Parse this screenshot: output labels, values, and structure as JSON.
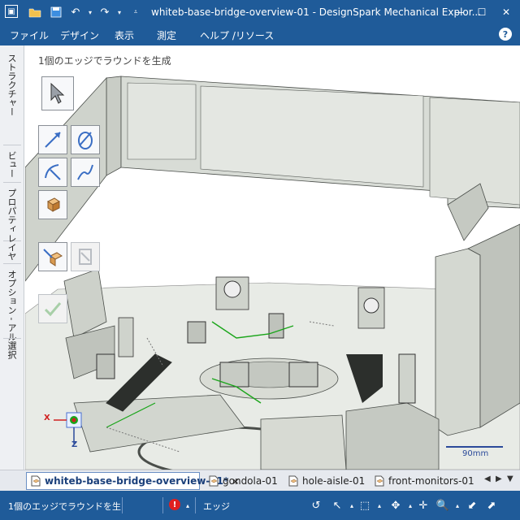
{
  "window": {
    "title": "whiteb-base-bridge-overview-01 - DesignSpark Mechanical Explor...",
    "minimize": "—",
    "maximize": "☐",
    "close": "✕"
  },
  "quick_access": {
    "app_icon": "cube-icon",
    "open": "folder-icon",
    "save": "save-icon",
    "undo": "undo-icon",
    "redo": "redo-icon",
    "customize": "dropdown-icon"
  },
  "menu": {
    "items": [
      "ファイル",
      "デザイン",
      "表示",
      "測定",
      "ヘルプ /リソース"
    ],
    "help": "?"
  },
  "side_tabs": [
    "ストラクチャー",
    "ビュー",
    "プロパティ",
    "レイヤ",
    "オプション - アル",
    "選択"
  ],
  "viewport": {
    "hint": "1個のエッジでラウンドを生成",
    "scale_label": "90mm",
    "axis_x": "X",
    "axis_z": "Z"
  },
  "tools": [
    {
      "name": "select-tool",
      "icon": "pointer-arrow-icon",
      "enabled": true
    },
    {
      "name": "edge-select-tool",
      "icon": "edge-arrow-icon",
      "enabled": true
    },
    {
      "name": "loop-select-tool",
      "icon": "loop-icon",
      "enabled": true
    },
    {
      "name": "round-edge-tool",
      "icon": "round-edge-icon",
      "enabled": true
    },
    {
      "name": "tangent-chain-tool",
      "icon": "tangent-chain-icon",
      "enabled": true
    },
    {
      "name": "solid-select-tool",
      "icon": "solid-box-icon",
      "enabled": true
    },
    {
      "name": "complete-tool",
      "icon": "complete-tool-icon",
      "enabled": true
    },
    {
      "name": "full-round-tool",
      "icon": "full-round-icon",
      "enabled": false
    },
    {
      "name": "confirm-tool",
      "icon": "checkmark-icon",
      "enabled": false
    }
  ],
  "doc_tabs": [
    {
      "label": "whiteb-base-bridge-overview-01*",
      "active": true,
      "close": "×"
    },
    {
      "label": "gondola-01",
      "active": false
    },
    {
      "label": "hole-aisle-01",
      "active": false
    },
    {
      "label": "front-monitors-01",
      "active": false
    }
  ],
  "doc_nav": {
    "prev": "◀",
    "next": "▶",
    "menu": "▼"
  },
  "status": {
    "text": "1個のエッジでラウンドを生",
    "error_badge": "!",
    "mode": "エッジ"
  },
  "colors": {
    "chrome_blue": "#1f5b99",
    "model_gray": "#d8dcd6",
    "model_edge": "#4a4e4a",
    "selection_green": "#1aa51a"
  }
}
